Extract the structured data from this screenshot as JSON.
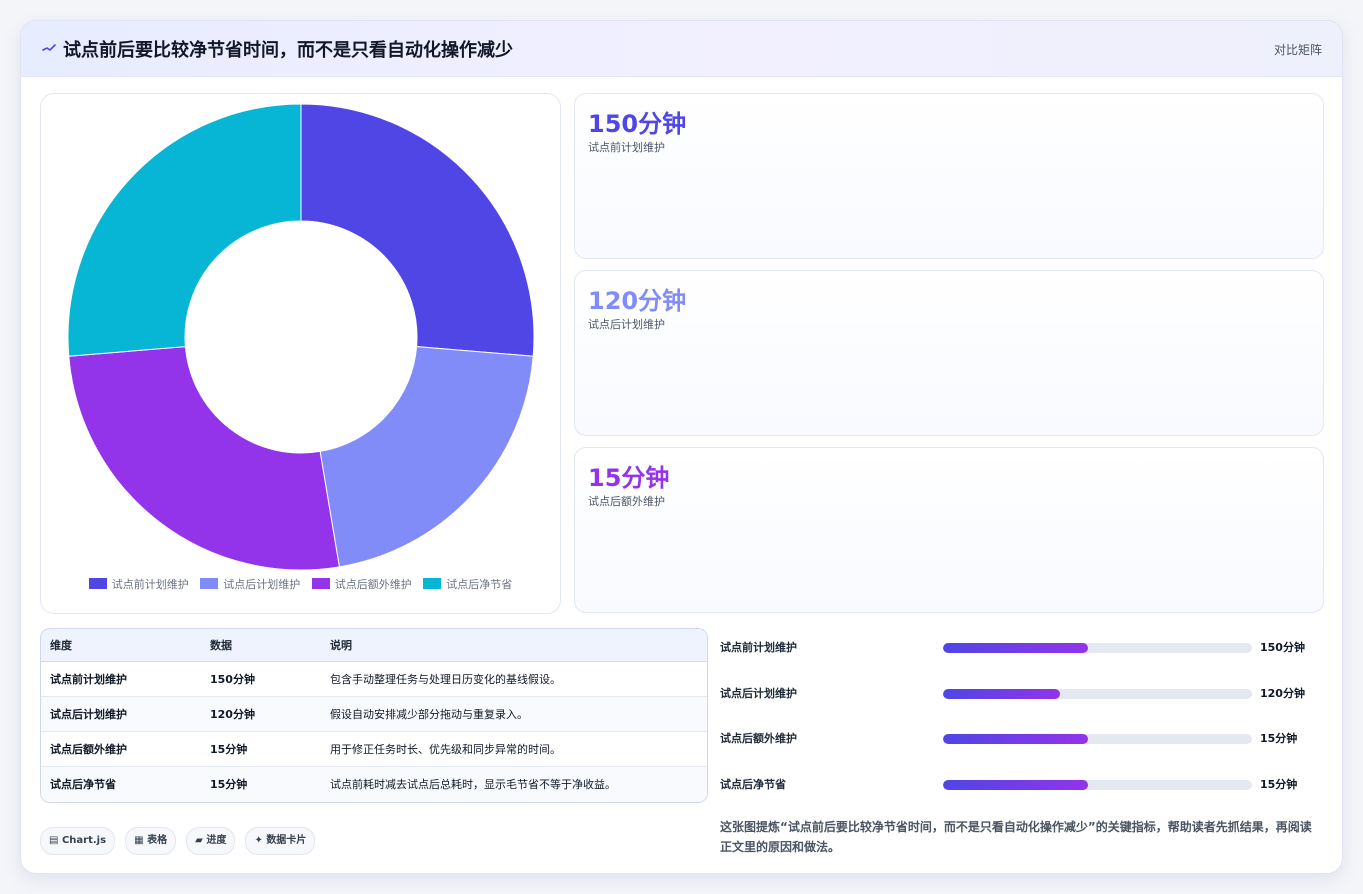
{
  "header": {
    "title": "试点前后要比较净节省时间，而不是只看自动化操作减少",
    "link_label": "对比矩阵",
    "icon": "sparkline-icon"
  },
  "chart_data": {
    "type": "pie",
    "categories": [
      "试点前计划维护",
      "试点后计划维护",
      "试点后额外维护",
      "试点后净节省"
    ],
    "values": [
      150,
      120,
      150,
      150
    ],
    "colors": [
      "#4f46e5",
      "#818cf8",
      "#9333ea",
      "#06b6d4"
    ],
    "legend_position": "bottom"
  },
  "kpis": [
    {
      "value": "150分钟",
      "label": "试点前计划维护",
      "color": "#4f46e5"
    },
    {
      "value": "120分钟",
      "label": "试点后计划维护",
      "color": "#818cf8"
    },
    {
      "value": "15分钟",
      "label": "试点后额外维护",
      "color": "#9333ea"
    }
  ],
  "table": {
    "headers": [
      "维度",
      "数据",
      "说明"
    ],
    "rows": [
      [
        "试点前计划维护",
        "150分钟",
        "包含手动整理任务与处理日历变化的基线假设。"
      ],
      [
        "试点后计划维护",
        "120分钟",
        "假设自动安排减少部分拖动与重复录入。"
      ],
      [
        "试点后额外维护",
        "15分钟",
        "用于修正任务时长、优先级和同步异常的时间。"
      ],
      [
        "试点后净节省",
        "15分钟",
        "试点前耗时减去试点后总耗时，显示毛节省不等于净收益。"
      ]
    ]
  },
  "bars": [
    {
      "label": "试点前计划维护",
      "value": "150分钟",
      "fraction": 0.47
    },
    {
      "label": "试点后计划维护",
      "value": "120分钟",
      "fraction": 0.38
    },
    {
      "label": "试点后额外维护",
      "value": "15分钟",
      "fraction": 0.47
    },
    {
      "label": "试点后净节省",
      "value": "15分钟",
      "fraction": 0.47
    }
  ],
  "tags": [
    {
      "label": "Chart.js",
      "icon": "chart-icon"
    },
    {
      "label": "表格",
      "icon": "table-icon"
    },
    {
      "label": "进度",
      "icon": "progress-icon"
    },
    {
      "label": "数据卡片",
      "icon": "sparkle-icon"
    }
  ],
  "summary": "这张图提炼“试点前后要比较净节省时间，而不是只看自动化操作减少”的关键指标，帮助读者先抓结果，再阅读正文里的原因和做法。"
}
